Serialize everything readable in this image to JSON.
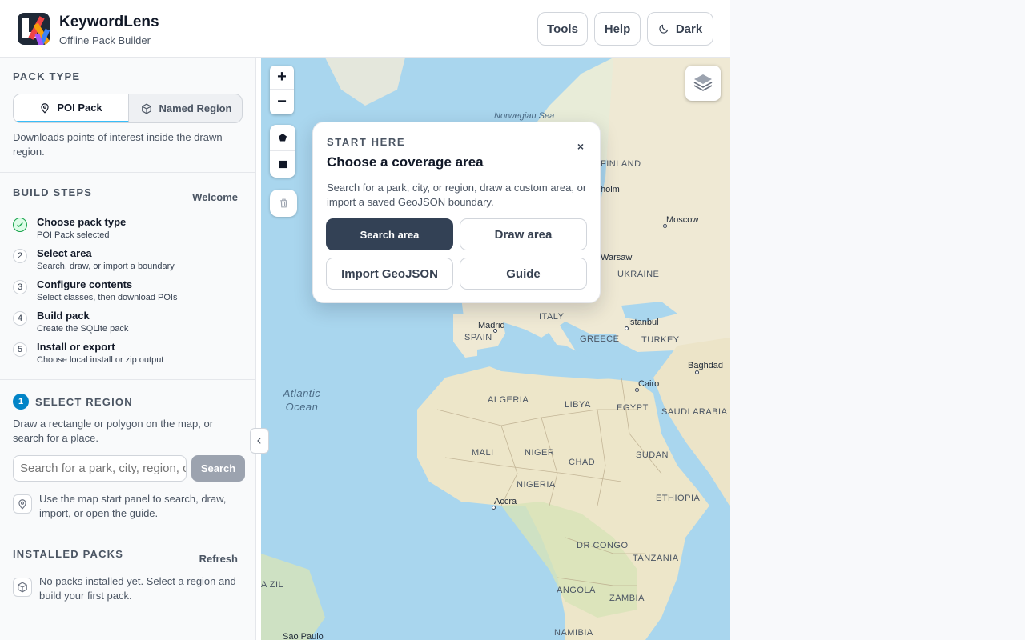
{
  "header": {
    "title": "KeywordLens",
    "subtitle": "Offline Pack Builder",
    "tools_label": "Tools",
    "help_label": "Help",
    "theme_label": "Dark"
  },
  "pack_type": {
    "section_title": "PACK TYPE",
    "options": [
      {
        "label": "POI Pack",
        "icon": "map-pin-icon",
        "selected": true
      },
      {
        "label": "Named Region",
        "icon": "cube-icon",
        "selected": false
      }
    ],
    "description": "Downloads points of interest inside the drawn region."
  },
  "build_steps": {
    "section_title": "BUILD STEPS",
    "link_label": "Welcome",
    "steps": [
      {
        "num": "✓",
        "title": "Choose pack type",
        "sub": "POI Pack selected",
        "done": true
      },
      {
        "num": "2",
        "title": "Select area",
        "sub": "Search, draw, or import a boundary",
        "done": false
      },
      {
        "num": "3",
        "title": "Configure contents",
        "sub": "Select classes, then download POIs",
        "done": false
      },
      {
        "num": "4",
        "title": "Build pack",
        "sub": "Create the SQLite pack",
        "done": false
      },
      {
        "num": "5",
        "title": "Install or export",
        "sub": "Choose local install or zip output",
        "done": false
      }
    ]
  },
  "select_region": {
    "badge": "1",
    "section_title": "SELECT REGION",
    "description": "Draw a rectangle or polygon on the map, or search for a place.",
    "search_placeholder": "Search for a park, city, region, or trail",
    "search_button": "Search",
    "hint": "Use the map start panel to search, draw, import, or open the guide."
  },
  "installed_packs": {
    "section_title": "INSTALLED PACKS",
    "link_label": "Refresh",
    "empty_text": "No packs installed yet. Select a region and build your first pack."
  },
  "map": {
    "zoom_in": "+",
    "zoom_out": "−",
    "labels": {
      "norwegian_sea": "Norwegian Sea",
      "finland": "FINLAND",
      "stockholm": "holm",
      "moscow": "Moscow",
      "warsaw": "Warsaw",
      "ukraine": "UKRAINE",
      "madrid": "Madrid",
      "spain": "SPAIN",
      "italy": "ITALY",
      "istanbul": "Istanbul",
      "greece": "GREECE",
      "turkey": "TURKEY",
      "baghdad": "Baghdad",
      "cairo": "Cairo",
      "atlantic_ocean_1": "Atlantic",
      "atlantic_ocean_2": "Ocean",
      "algeria": "ALGERIA",
      "libya": "LIBYA",
      "egypt": "EGYPT",
      "saudi_arabia": "SAUDI ARABIA",
      "mali": "MALI",
      "niger": "NIGER",
      "chad": "CHAD",
      "sudan": "SUDAN",
      "nigeria": "NIGERIA",
      "ethiopia": "ETHIOPIA",
      "accra": "Accra",
      "dr_congo": "DR CONGO",
      "tanzania": "TANZANIA",
      "brazil": "A ZIL",
      "angola": "ANGOLA",
      "zambia": "ZAMBIA",
      "sao_paulo": "Sao Paulo",
      "namibia": "NAMIBIA"
    }
  },
  "start_panel": {
    "kicker": "START HERE",
    "close": "×",
    "title": "Choose a coverage area",
    "description": "Search for a park, city, or region, draw a custom area, or import a saved GeoJSON boundary.",
    "buttons": {
      "search_area": "Search area",
      "draw_area": "Draw area",
      "import_geojson": "Import GeoJSON",
      "guide": "Guide"
    }
  },
  "colors": {
    "ocean": "#a9d6ee",
    "land": "#efe9d4",
    "primary_button": "#334155",
    "accent": "#0284c7",
    "success": "#16a34a"
  }
}
